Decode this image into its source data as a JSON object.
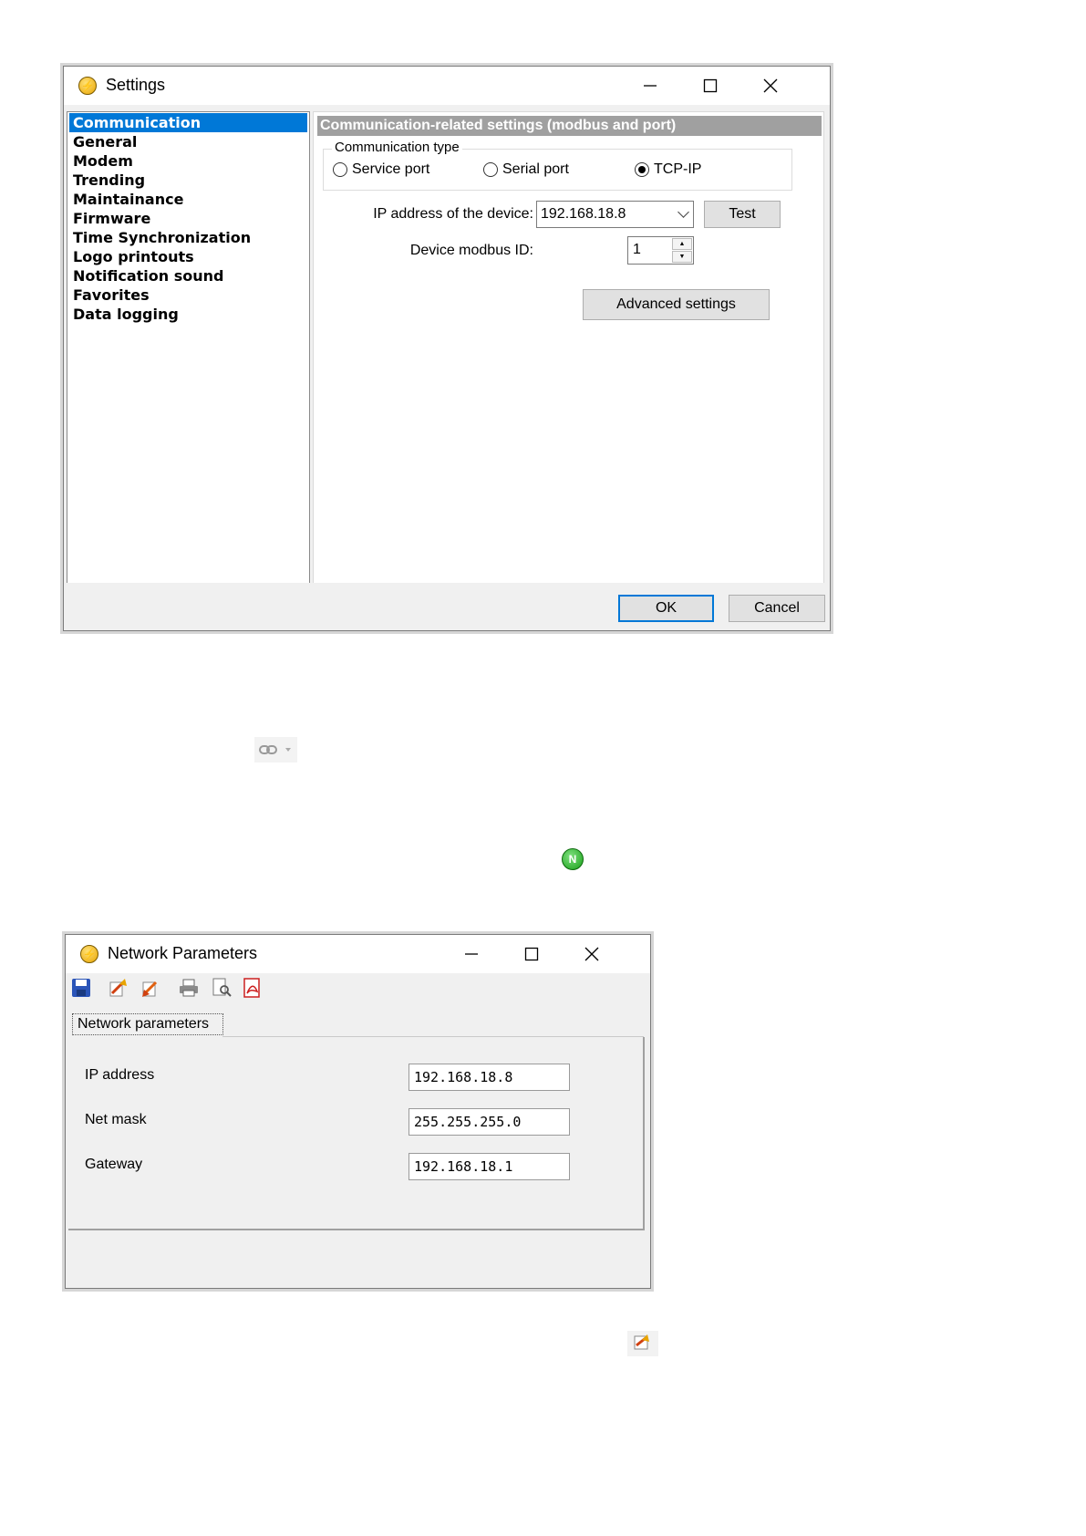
{
  "settings": {
    "title": "Settings",
    "nav": [
      {
        "label": "Communication",
        "selected": true
      },
      {
        "label": "General"
      },
      {
        "label": "Modem"
      },
      {
        "label": "Trending"
      },
      {
        "label": "Maintainance"
      },
      {
        "label": "Firmware"
      },
      {
        "label": "Time Synchronization"
      },
      {
        "label": "Logo printouts"
      },
      {
        "label": "Notification sound"
      },
      {
        "label": "Favorites"
      },
      {
        "label": "Data logging"
      }
    ],
    "section_title": "Communication-related settings (modbus and port)",
    "comm_type": {
      "title": "Communication type",
      "options": [
        "Service port",
        "Serial port",
        "TCP-IP"
      ],
      "selected": "TCP-IP"
    },
    "ip_label": "IP address of the device:",
    "ip_value": "192.168.18.8",
    "test_label": "Test",
    "modbus_label": "Device modbus ID:",
    "modbus_value": "1",
    "advanced_label": "Advanced settings",
    "ok_label": "OK",
    "cancel_label": "Cancel",
    "accent_color": "#0078d7"
  },
  "network": {
    "title": "Network Parameters",
    "toolbar_icons": [
      "save-icon",
      "export-icon",
      "import-icon",
      "print-icon",
      "print-preview-icon",
      "pdf-icon"
    ],
    "tab_label": "Network parameters",
    "fields": [
      {
        "label": "IP address",
        "value": "192.168.18.8"
      },
      {
        "label": "Net mask",
        "value": "255.255.255.0"
      },
      {
        "label": "Gateway",
        "value": "192.168.18.1"
      }
    ]
  },
  "floating_icons": {
    "network-dropdown-icon": "gray-link",
    "green_badge_letter": "N",
    "import-icon": "import"
  }
}
